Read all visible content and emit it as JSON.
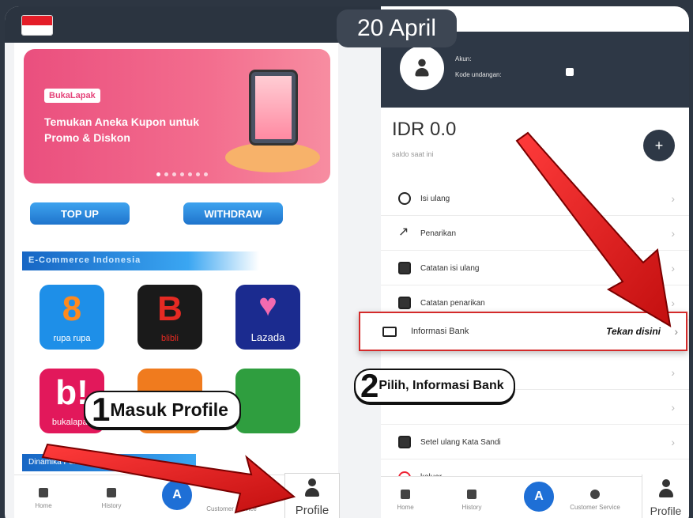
{
  "date_badge": "20 April",
  "left_phone": {
    "banner": {
      "logo": "BukaLapak",
      "headline": "Temukan Aneka Kupon untuk Promo & Diskon"
    },
    "buttons": {
      "top_up": "TOP UP",
      "withdraw": "WITHDRAW"
    },
    "section_title": "E-Commerce Indonesia",
    "apps": [
      {
        "name": "8",
        "label": "rupa rupa",
        "color": "#1e8fe8"
      },
      {
        "name": "B",
        "label": "blibli",
        "color": "#1a1a1a"
      },
      {
        "name": "Lazada",
        "label": "Lazada",
        "color": "#1b2b8f"
      },
      {
        "name": "b!",
        "label": "bukalapak",
        "color": "#e2185b"
      },
      {
        "name": "",
        "label": "",
        "color": "#f07b1e"
      },
      {
        "name": "",
        "label": "",
        "color": "#2f9e3f"
      }
    ],
    "section2_title": "Dinamika Perusaha...",
    "nav": [
      "Home",
      "History",
      "Customer Service"
    ],
    "profile_tab": "Profile"
  },
  "right_phone": {
    "account": {
      "akun_label": "Akun:",
      "kode_label": "Kode undangan:"
    },
    "balance": {
      "amount": "IDR 0.0",
      "sub": "saldo saat ini"
    },
    "menu": [
      {
        "label": "Isi ulang"
      },
      {
        "label": "Penarikan"
      },
      {
        "label": "Catatan isi ulang"
      },
      {
        "label": "Catatan penarikan"
      },
      {
        "label": ""
      },
      {
        "label": ""
      },
      {
        "label": ""
      },
      {
        "label": "Setel ulang Kata Sandi"
      },
      {
        "label": "keluar"
      }
    ],
    "bank_row": {
      "label": "Informasi Bank",
      "hint": "Tekan disini"
    },
    "nav": [
      "Home",
      "History",
      "Customer Service"
    ],
    "profile_tab": "Profile"
  },
  "steps": [
    {
      "number": "1",
      "text": "Masuk Profile"
    },
    {
      "number": "2",
      "text": "Pilih, Informasi Bank"
    }
  ],
  "colors": {
    "arrow": "#e31b1b",
    "dark_header": "#2e3846",
    "accent_blue": "#1e74d2"
  }
}
